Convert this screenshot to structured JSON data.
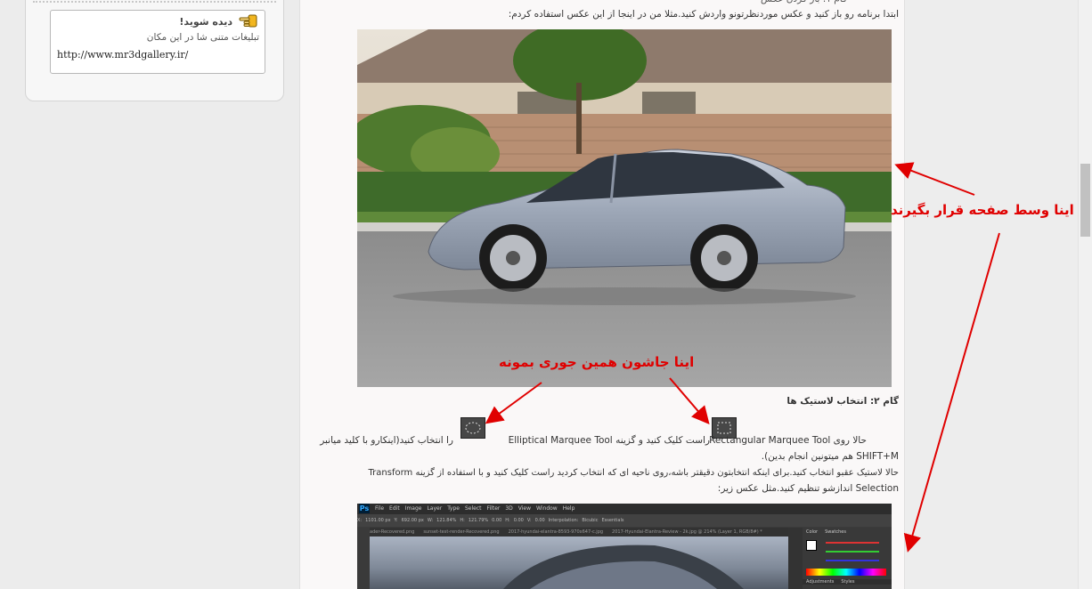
{
  "sidebar": {
    "ad_title": "دیده شوید!",
    "ad_subtitle": "تبلیغات متنی شا در این مکان",
    "ad_url": "http://www.mr3dgallery.ir/",
    "ad_icon": "pointing-hand-icon"
  },
  "article": {
    "step1_heading_partial": "گام ۱: باز کردن عکس",
    "intro": "ابتدا برنامه رو باز کنید و عکس مورد‌نظرتونو واردش کنید.مثلا من در اینجا از این عکس استفاده کردم:",
    "step2_heading": "گام ۲: انتخاب لاستیک ها",
    "step2_line1_a": "حالا روی Rectangular Marquee Tool",
    "step2_line1_b": "راست کلیک کنید و گزینه Elliptical Marquee Tool",
    "step2_line1_c": "را انتخاب کنید(اینکارو با کلید میانبر",
    "step2_line2": "SHIFT+M هم میتونین انجام بدین).",
    "step2_para2_line1": "حالا لاستیک عقبو انتخاب کنید.برای اینکه انتخابتون دقیقتر باشه،روی ناحیه ای که انتخاب کردید راست کلیک کنید و با استفاده از گزینه Transform",
    "step2_para2_line2": "Selection اندازشو تنظیم کنید.مثل عکس زیر:",
    "photo_alt": "car-photo",
    "ps_tabs": [
      "ader-Recovered.png",
      "sunset-test-render-Recovered.png",
      "2017-hyundai-elantra-8593-970x647-c.jpg",
      "2017-Hyundai-Elantra-Review - 2k.jpg @ 214% (Layer 1, RGB/8#) *"
    ],
    "ps_menu": [
      "File",
      "Edit",
      "Image",
      "Layer",
      "Type",
      "Select",
      "Filter",
      "3D",
      "View",
      "Window",
      "Help"
    ],
    "ps_options": [
      "X:",
      "1101.00 px",
      "Y:",
      "692.00 px",
      "W:",
      "121.84%",
      "H:",
      "121.79%",
      "0.00",
      "H:",
      "0.00",
      "V:",
      "0.00",
      "Interpolation:",
      "Bicubic",
      "Essentials"
    ],
    "ps_panels": [
      "Color",
      "Swatches",
      "Adjustments",
      "Styles"
    ],
    "ps_logo": "Ps"
  },
  "annotations": {
    "center_note": "اینا وسط صفحه قرار بگیرند",
    "tools_note": "اینا جاشون همین جوری بمونه",
    "color": "#e00000"
  }
}
